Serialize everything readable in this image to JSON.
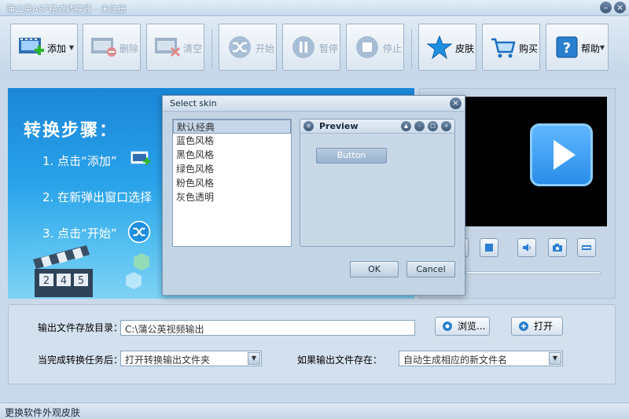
{
  "window": {
    "title": "蒲公英ASF格式转换器 - 未注册",
    "min": "–",
    "close": "×"
  },
  "toolbar": {
    "add": "添加",
    "delete": "删除",
    "clear": "清空",
    "start": "开始",
    "pause": "暂停",
    "stop": "停止",
    "skin": "皮肤",
    "buy": "购买",
    "help": "帮助",
    "dropdown_arrow": "▼"
  },
  "guide": {
    "title": "转换步骤：",
    "step1": "1. 点击“添加”",
    "step2": "2. 在新弹出窗口选择",
    "step3": "3. 点击“开始”",
    "clapper_numbers": [
      "2",
      "4",
      "5"
    ]
  },
  "output": {
    "dir_label": "输出文件存放目录：",
    "dir_value": "C:\\蒲公英视频输出",
    "browse": "浏览...",
    "open": "打开",
    "after_label": "当完成转换任务后：",
    "after_value": "打开转换输出文件夹",
    "exists_label": "如果输出文件存在：",
    "exists_value": "自动生成相应的新文件名"
  },
  "status": {
    "text": "更换软件外观皮肤"
  },
  "dialog": {
    "title": "Select skin",
    "close": "×",
    "skins": [
      "默认经典",
      "蓝色风格",
      "黑色风格",
      "绿色风格",
      "粉色风格",
      "灰色透明"
    ],
    "selected_index": 0,
    "preview_title": "Preview",
    "preview_button": "Button",
    "ok": "OK",
    "cancel": "Cancel"
  }
}
